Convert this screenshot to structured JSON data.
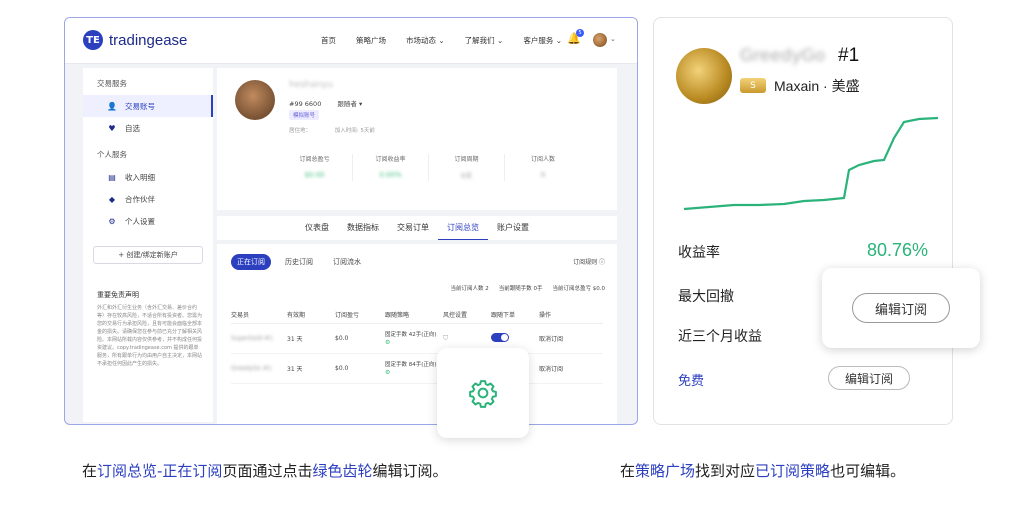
{
  "left": {
    "brand": "tradingease",
    "nav": [
      "首页",
      "策略广场",
      "市场动态 ⌄",
      "了解我们 ⌄",
      "客户服务 ⌄"
    ],
    "bell_count": "5",
    "sidebar": {
      "section1": "交易服务",
      "items1": [
        {
          "icon": "user-icon",
          "label": "交易账号",
          "active": true
        },
        {
          "icon": "heart-icon",
          "label": "自选",
          "active": false
        }
      ],
      "section2": "个人服务",
      "items2": [
        {
          "icon": "list-icon",
          "label": "收入明细"
        },
        {
          "icon": "gem-icon",
          "label": "合作伙伴"
        },
        {
          "icon": "gear-icon",
          "label": "个人设置"
        }
      ],
      "create_button": "+ 创建/绑定新账户",
      "disclaimer_title": "重要免责声明",
      "disclaimer_text": "外汇和外汇衍生业务（含外汇交易、差价合约等）存在较高风险，不适合所有投资者。您需为您的交易行为承担风险，且有可能会面临全部本金的损失。请确保您在参与前已充分了解相关风险。本网站所载内容仅供参考，并不构成任何投资建议。copy.tradingease.com 提供的跟单服务，所有跟单行为均由用户自主决定，本网站不承担任何因此产生的损失。"
    },
    "profile": {
      "name": "heshanyu",
      "id": "#99  6600",
      "role": "跟随者 ▾",
      "tag": "模拟账号",
      "meta_location": "居住地：",
      "meta_joined": "加入时间: 5天前",
      "stats": [
        {
          "label": "订阅总盈亏",
          "value": "$0.00"
        },
        {
          "label": "订阅收益率",
          "value": "0.00%"
        },
        {
          "label": "订阅周期",
          "value": "0天"
        },
        {
          "label": "订阅人数",
          "value": "0"
        }
      ]
    },
    "tabs": [
      "仪表盘",
      "数据指标",
      "交易订单",
      "订阅总览",
      "账户设置"
    ],
    "active_tab": "订阅总览",
    "subtabs": [
      "正在订阅",
      "历史订阅",
      "订阅流水"
    ],
    "rule_link": "订阅规则 ⓘ",
    "summary": [
      "当前订阅人数  2",
      "当前跟随手数  0手",
      "当前订阅总盈亏  $0.0"
    ],
    "table": {
      "headers": [
        "交易员",
        "有效期",
        "订阅盈亏",
        "跟随策略",
        "风控设置",
        "跟随下单",
        "操作"
      ],
      "rows": [
        {
          "trader": "SuperGold #1",
          "valid": "31 天",
          "pnl": "$0.0",
          "strategy": "固定手数 42手(正向)",
          "action": "取消订阅"
        },
        {
          "trader": "GreedyGo #1",
          "valid": "31 天",
          "pnl": "$0.0",
          "strategy": "固定手数 84手(正向)",
          "action": "取消订阅"
        }
      ]
    }
  },
  "right": {
    "name": "GreedyGo",
    "rank": "#1",
    "badge": "S",
    "broker": "Maxain · 美盛",
    "metrics": [
      {
        "label": "收益率",
        "value": "80.76%"
      },
      {
        "label": "最大回撤",
        "value": ""
      },
      {
        "label": "近三个月收益",
        "value": ""
      }
    ],
    "free_label": "免费",
    "edit_label": "编辑订阅",
    "popup_edit_label": "编辑订阅",
    "line_color": "#2bb37a"
  },
  "captions": {
    "left": [
      {
        "t": "在",
        "hl": ""
      },
      {
        "t": "订阅总览-正在订阅",
        "hl": "blue"
      },
      {
        "t": "页面通过点击",
        "hl": ""
      },
      {
        "t": "绿色齿轮",
        "hl": "blue"
      },
      {
        "t": "编辑订阅。",
        "hl": ""
      }
    ],
    "right": [
      {
        "t": "在",
        "hl": ""
      },
      {
        "t": "策略广场",
        "hl": "blue"
      },
      {
        "t": "找到对应",
        "hl": ""
      },
      {
        "t": "已订阅策略",
        "hl": "blue"
      },
      {
        "t": "也可编辑。",
        "hl": ""
      }
    ]
  }
}
